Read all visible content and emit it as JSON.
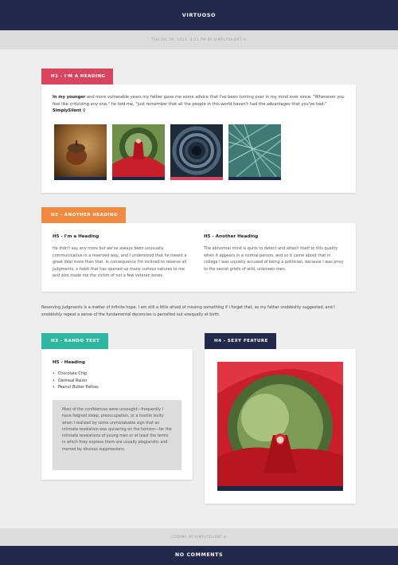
{
  "header": {
    "site_title": "VIRTUOSO"
  },
  "meta": {
    "date_line": "TUE JUL 29, 2014, 4:21 PM BY SIMPLYSILENT",
    "pin_glyph": "♀"
  },
  "section1": {
    "label": "H1 - I'M A HEADING",
    "lead_bold": "In my younger",
    "lead_text": " and more vulnerable years my father gave me some advice that I've been turning over in my mind ever since. \"Whenever you feel like criticizing any one,\" he told me, \"just remember that all the people in this world haven't had the advantages that you've had.\"",
    "signature": "SimplySilent",
    "thumbnails": [
      "acorn-photo",
      "red-cloak-photo",
      "spiral-staircase-photo",
      "palm-leaves-photo"
    ]
  },
  "section2": {
    "label": "H2 - ANOTHER HEADING",
    "col1": {
      "heading": "H5 - I'm a Heading",
      "text": "He didn't say any more but we've always been unusually communicative in a reserved way, and I understood that he meant a great deal more than that. In consequence I'm inclined to reserve all judgments, a habit that has opened up many curious natures to me and also made me the victim of not a few veteran bores."
    },
    "col2": {
      "heading": "H5 - Another Heading",
      "text": "The abnormal mind is quick to detect and attach itself to this quality when it appears in a normal person, and so it came about that in college I was unjustly accused of being a politician, because I was privy to the secret griefs of wild, unknown men."
    }
  },
  "body_paragraph": "Reserving judgments is a matter of infinite hope. I am still a little afraid of missing something if I forget that, as my father snobbishly suggested, and I snobbishly repeat a sense of the fundamental decencies is parcelled out unequally at birth.",
  "section3": {
    "label": "H3 - RANDO TEXT",
    "heading": "H5 - Heading",
    "list": [
      "Chocolate Chip",
      "Oatmeal Raisin",
      "Peanut Butter Patties"
    ],
    "quote": "Most of the confidences were unsought—frequently I have feigned sleep, preoccupation, or a hostile levity when I realized by some unmistakable sign that an intimate revelation was quivering on the horizon—for the intimate revelations of young men or at least the terms in which they express them are usually plagiaristic and marred by obvious suppressions."
  },
  "section4": {
    "label": "H4 - SEXY FEATURE",
    "image": "red-cloak-feature-photo"
  },
  "footer": {
    "credit": "CODING BY SIMPLYSILENT",
    "comments": "NO COMMENTS"
  },
  "colors": {
    "navy": "#22294a",
    "pink": "#d9455f",
    "orange": "#f08a40",
    "teal": "#2fb6a0"
  }
}
